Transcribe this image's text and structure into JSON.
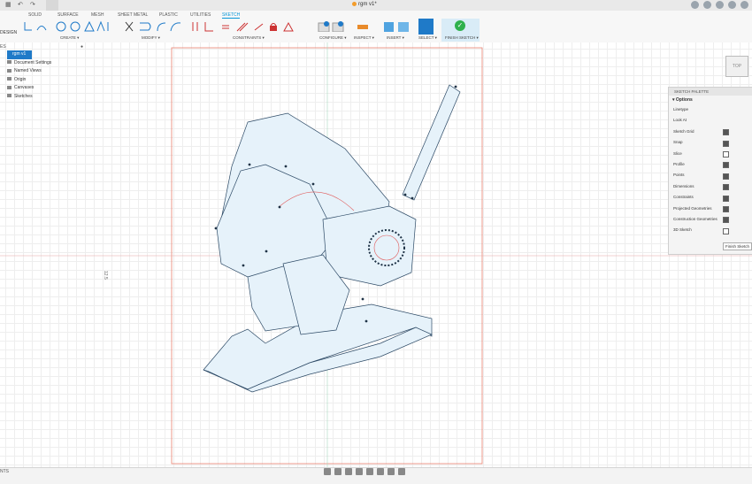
{
  "document": {
    "title": "rgm v1*"
  },
  "workspace": {
    "label": "DESIGN"
  },
  "tabs": [
    "SOLID",
    "SURFACE",
    "MESH",
    "SHEET METAL",
    "PLASTIC",
    "UTILITIES",
    "SKETCH"
  ],
  "active_tab": "SKETCH",
  "tool_groups": {
    "create": "CREATE ▾",
    "modify": "MODIFY ▾",
    "constraints": "CONSTRAINTS ▾",
    "configure": "CONFIGURE ▾",
    "inspect": "INSPECT ▾",
    "insert": "INSERT ▾",
    "select": "SELECT ▾",
    "finish": "FINISH SKETCH ▾"
  },
  "browser": {
    "title": "ES",
    "root": "rgm v1",
    "items": [
      "Document Settings",
      "Named Views",
      "Origin",
      "Canvases",
      "Sketches"
    ]
  },
  "dimension_label": "12.5",
  "viewcube": {
    "label": "TOP"
  },
  "sketch_palette": {
    "title": "SKETCH PALETTE",
    "options_label": "Options",
    "rows": [
      {
        "label": "Linetype",
        "checked": null
      },
      {
        "label": "Look At",
        "checked": null
      },
      {
        "label": "Sketch Grid",
        "checked": true
      },
      {
        "label": "Snap",
        "checked": true
      },
      {
        "label": "Slice",
        "checked": false
      },
      {
        "label": "Profile",
        "checked": true
      },
      {
        "label": "Points",
        "checked": true
      },
      {
        "label": "Dimensions",
        "checked": true
      },
      {
        "label": "Constraints",
        "checked": true
      },
      {
        "label": "Projected Geometries",
        "checked": true
      },
      {
        "label": "Construction Geometries",
        "checked": true
      },
      {
        "label": "3D Sketch",
        "checked": false
      }
    ],
    "finish_label": "Finish Sketch"
  },
  "comments": {
    "label": "NTS"
  },
  "colors": {
    "accent": "#0696d7",
    "finish": "#2fb14d",
    "sketch_fill": "#e6f2fa",
    "sketch_line": "#2d4a66",
    "profile": "#e05a5a"
  }
}
